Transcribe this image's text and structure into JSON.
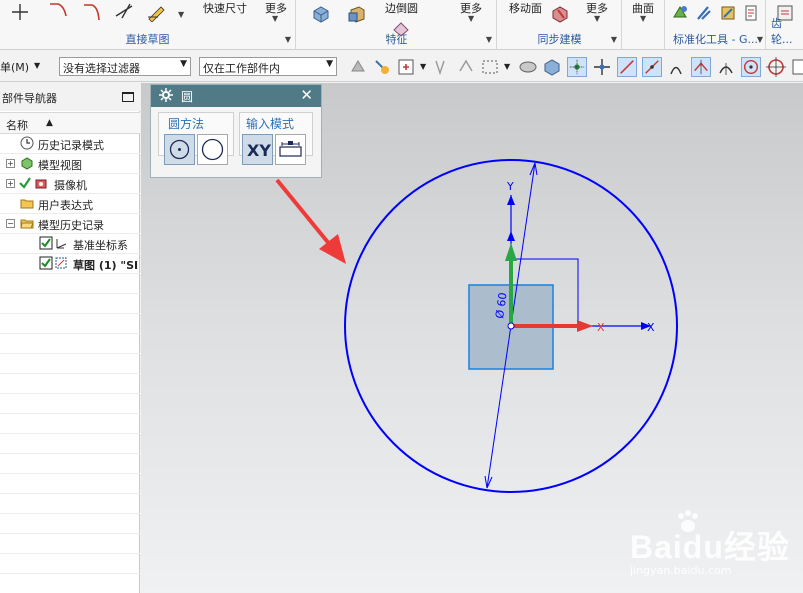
{
  "ribbon": {
    "groups": {
      "direct_sketch": "直接草图",
      "feature": "特征",
      "sync_modeling": "同步建模",
      "standard_tools": "标准化工具 - G...",
      "gear": "齿轮..."
    },
    "buttons": {
      "quick_dimension": "快速尺寸",
      "more_1": "更多",
      "edge_chamfer": "边倒圆",
      "more_2": "更多",
      "move_face": "移动面",
      "more_3": "更多",
      "surface": "曲面"
    }
  },
  "toolbar": {
    "menu_label": "单(M)",
    "filter_select": "没有选择过滤器",
    "scope_select": "仅在工作部件内"
  },
  "navigator": {
    "title": "部件导航器",
    "column_name": "名称",
    "items": [
      {
        "label": "历史记录模式"
      },
      {
        "label": "模型视图"
      },
      {
        "label": "摄像机"
      },
      {
        "label": "用户表达式"
      },
      {
        "label": "模型历史记录"
      },
      {
        "label": "基准坐标系"
      },
      {
        "label": "草图 (1) \"SI"
      }
    ]
  },
  "dialog": {
    "title": "圆",
    "circle_method_label": "圆方法",
    "input_mode_label": "输入模式",
    "xy_label": "XY"
  },
  "canvas": {
    "axis_y": "Y",
    "axis_x_red": "X",
    "axis_x_blue": "X",
    "dimension_text": "Ø 60",
    "circle_color": "#0000ff",
    "arrow_color": "#ef3a3a"
  },
  "watermark": {
    "brand": "Baidu经验",
    "url": "jingyan.baidu.com"
  }
}
